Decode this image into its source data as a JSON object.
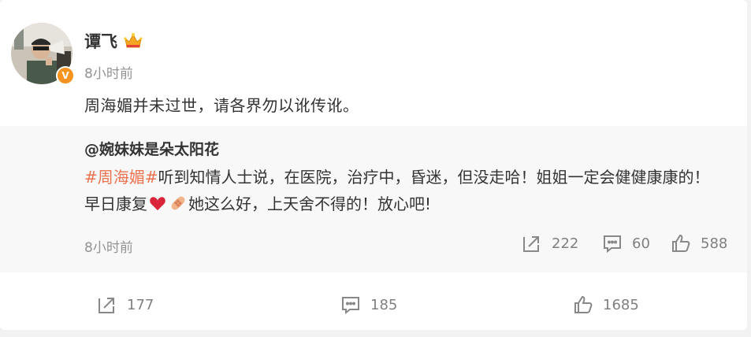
{
  "post": {
    "author": "谭飞",
    "time": "8小时前",
    "text": "周海媚并未过世，请各界勿以讹传讹。",
    "verified_badge": "V",
    "accent": "#eb7350"
  },
  "retweet": {
    "user": "@婉妹妹是朵太阳花",
    "hashtag": "#周海媚#",
    "text_part1": "听到知情人士说，在医院，治疗中，昏迷，但没走哈！姐姐一定会健健康康的！早日康复",
    "text_part2": "她这么好，上天舍不得的！放心吧!",
    "time": "8小时前",
    "repost_count": "222",
    "comment_count": "60",
    "like_count": "588"
  },
  "footer": {
    "repost_count": "177",
    "comment_count": "185",
    "like_count": "1685"
  }
}
